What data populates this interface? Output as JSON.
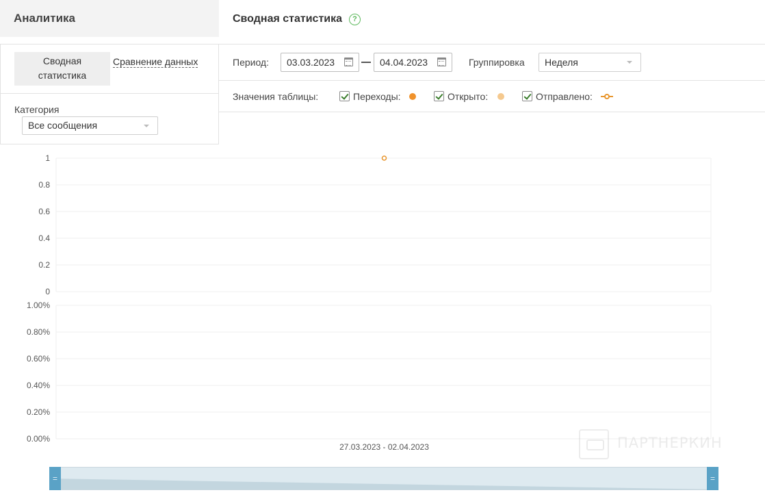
{
  "sidebar": {
    "title": "Аналитика",
    "tabs": [
      {
        "label": "Сводная\nстатистика",
        "line1": "Сводная",
        "line2": "статистика",
        "active": true
      },
      {
        "label": "Сравнение данных",
        "active": false
      }
    ],
    "category": {
      "label": "Категория",
      "value": "Все сообщения"
    }
  },
  "main": {
    "title": "Сводная статистика",
    "help_icon": "question-circle-icon",
    "period": {
      "label": "Период:",
      "from": "03.03.2023",
      "to": "04.04.2023"
    },
    "grouping": {
      "label": "Группировка",
      "value": "Неделя"
    },
    "table_values": {
      "label": "Значения таблицы:",
      "items": [
        {
          "label": "Переходы:",
          "checked": true,
          "color": "#f0922b",
          "marker": "dot"
        },
        {
          "label": "Открыто:",
          "checked": true,
          "color": "#f5c98f",
          "marker": "dot"
        },
        {
          "label": "Отправлено:",
          "checked": true,
          "color": "#e8962e",
          "marker": "line-circle"
        }
      ]
    }
  },
  "chart_data": [
    {
      "type": "line",
      "title": "",
      "xlabel": "",
      "ylabel": "",
      "categories": [
        "27.03.2023 - 02.04.2023"
      ],
      "ylim": [
        0,
        1
      ],
      "yticks": [
        "1",
        "0.8",
        "0.6",
        "0.4",
        "0.2",
        "0"
      ],
      "series": [
        {
          "values": [
            1
          ],
          "color": "#e8962e"
        }
      ],
      "grid": true
    },
    {
      "type": "line",
      "title": "",
      "xlabel": "",
      "ylabel": "",
      "categories": [
        "27.03.2023 - 02.04.2023"
      ],
      "ylim": [
        0,
        1
      ],
      "yticks": [
        "1.00%",
        "0.80%",
        "0.60%",
        "0.40%",
        "0.20%",
        "0.00%"
      ],
      "series": [],
      "grid": true
    }
  ],
  "watermark": {
    "text": "ПАРТНЕРКИН",
    "icon": "partnerkin-logo-icon"
  },
  "navigator": {
    "handle_glyph": "="
  }
}
